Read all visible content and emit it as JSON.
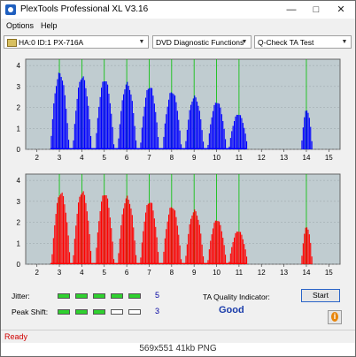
{
  "window": {
    "title": "PlexTools Professional XL V3.16"
  },
  "menu": {
    "options": "Options",
    "help": "Help"
  },
  "toolbar": {
    "drive": "HA:0 ID:1  PX-716A",
    "function": "DVD Diagnostic Functions",
    "test": "Q-Check TA Test"
  },
  "colors": {
    "top_bars": "#0000ff",
    "bottom_bars": "#ff0000",
    "marker_lines": "#00c000",
    "plot_background": "#c0ccd0"
  },
  "chart_data": [
    {
      "type": "bar",
      "title": "",
      "xlabel": "",
      "ylabel": "",
      "x_ticks": [
        2,
        3,
        4,
        5,
        6,
        7,
        8,
        9,
        10,
        11,
        12,
        13,
        14,
        15
      ],
      "y_ticks": [
        0,
        1,
        2,
        3,
        4
      ],
      "xlim": [
        1.5,
        15.5
      ],
      "ylim": [
        0,
        4.3
      ],
      "grid": true,
      "marker_lines_at": [
        3,
        4,
        5,
        6,
        7,
        8,
        9,
        10,
        11,
        14
      ],
      "color": "#0000ff",
      "peaks": [
        {
          "center": 3.0,
          "height": 3.75,
          "width": 0.42
        },
        {
          "center": 4.0,
          "height": 3.6,
          "width": 0.42
        },
        {
          "center": 5.0,
          "height": 3.45,
          "width": 0.42
        },
        {
          "center": 6.0,
          "height": 3.25,
          "width": 0.42
        },
        {
          "center": 7.0,
          "height": 3.1,
          "width": 0.42
        },
        {
          "center": 8.0,
          "height": 2.85,
          "width": 0.42
        },
        {
          "center": 9.0,
          "height": 2.6,
          "width": 0.42
        },
        {
          "center": 10.0,
          "height": 2.35,
          "width": 0.42
        },
        {
          "center": 10.95,
          "height": 1.75,
          "width": 0.42
        },
        {
          "center": 14.0,
          "height": 1.95,
          "width": 0.25
        }
      ],
      "baseline_range": [
        2.6,
        11.35
      ]
    },
    {
      "type": "bar",
      "title": "",
      "xlabel": "",
      "ylabel": "",
      "x_ticks": [
        2,
        3,
        4,
        5,
        6,
        7,
        8,
        9,
        10,
        11,
        12,
        13,
        14,
        15
      ],
      "y_ticks": [
        0,
        1,
        2,
        3,
        4
      ],
      "xlim": [
        1.5,
        15.5
      ],
      "ylim": [
        0,
        4.3
      ],
      "grid": true,
      "marker_lines_at": [
        3,
        4,
        5,
        6,
        7,
        8,
        9,
        10,
        11,
        14
      ],
      "color": "#ff0000",
      "peaks": [
        {
          "center": 3.05,
          "height": 3.55,
          "width": 0.42
        },
        {
          "center": 4.0,
          "height": 3.6,
          "width": 0.42
        },
        {
          "center": 5.0,
          "height": 3.5,
          "width": 0.42
        },
        {
          "center": 6.0,
          "height": 3.3,
          "width": 0.42
        },
        {
          "center": 7.0,
          "height": 3.1,
          "width": 0.42
        },
        {
          "center": 8.0,
          "height": 2.85,
          "width": 0.42
        },
        {
          "center": 9.0,
          "height": 2.65,
          "width": 0.42
        },
        {
          "center": 10.0,
          "height": 2.2,
          "width": 0.42
        },
        {
          "center": 10.95,
          "height": 1.65,
          "width": 0.42
        },
        {
          "center": 14.0,
          "height": 1.85,
          "width": 0.25
        }
      ],
      "baseline_range": [
        2.6,
        11.35
      ]
    }
  ],
  "jitter": {
    "label": "Jitter:",
    "value": "5",
    "level": 5,
    "max": 5
  },
  "peak_shift": {
    "label": "Peak Shift:",
    "value": "3",
    "level": 3,
    "max": 5
  },
  "ta_quality": {
    "label": "TA Quality Indicator:",
    "value": "Good"
  },
  "buttons": {
    "start": "Start"
  },
  "status": {
    "text": "Ready"
  },
  "footer": {
    "text": "569x551  41kb  PNG"
  }
}
